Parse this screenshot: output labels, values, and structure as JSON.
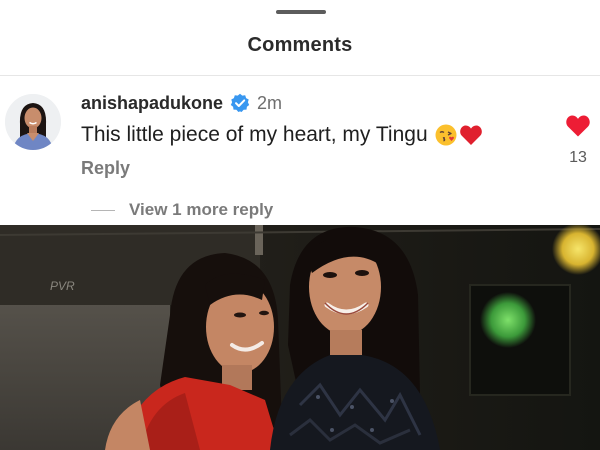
{
  "sheet": {
    "title": "Comments"
  },
  "comment": {
    "username": "anishapadukone",
    "verified": true,
    "timestamp": "2m",
    "text": "This little piece of my heart, my Tingu",
    "emojis": [
      "kissing-face-with-heart",
      "red-heart"
    ],
    "reply_label": "Reply",
    "like_count": "13",
    "liked": true
  },
  "replies": {
    "view_more_label": "View 1 more reply"
  },
  "photo": {
    "sign_text": "PVR"
  },
  "colors": {
    "like_red": "#ed1d35",
    "verified_blue": "#3897f0",
    "text_primary": "#1f1f1f",
    "text_secondary": "#7a7a7a"
  }
}
